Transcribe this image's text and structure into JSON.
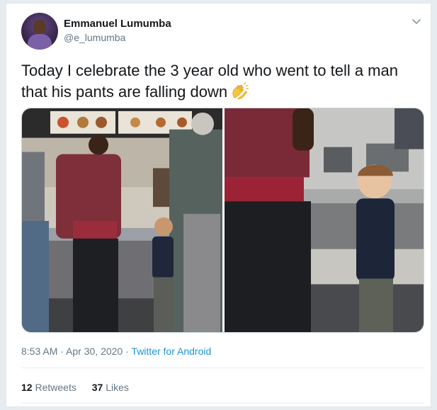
{
  "user": {
    "display_name": "Emmanuel Lumumba",
    "handle": "@e_lumumba"
  },
  "tweet": {
    "text": "Today I celebrate the 3 year old who went to tell a man that his pants are falling down",
    "emoji": "clapping-hands"
  },
  "meta": {
    "time": "8:53 AM",
    "separator1": " · ",
    "date": "Apr 30, 2020",
    "separator2": " · ",
    "source": "Twitter for Android"
  },
  "stats": {
    "retweets_count": "12",
    "retweets_label": "Retweets",
    "likes_count": "37",
    "likes_label": "Likes"
  },
  "colors": {
    "link": "#1b95e0",
    "text": "#14171a",
    "secondary": "#657786",
    "background": "#e6ecf0"
  }
}
